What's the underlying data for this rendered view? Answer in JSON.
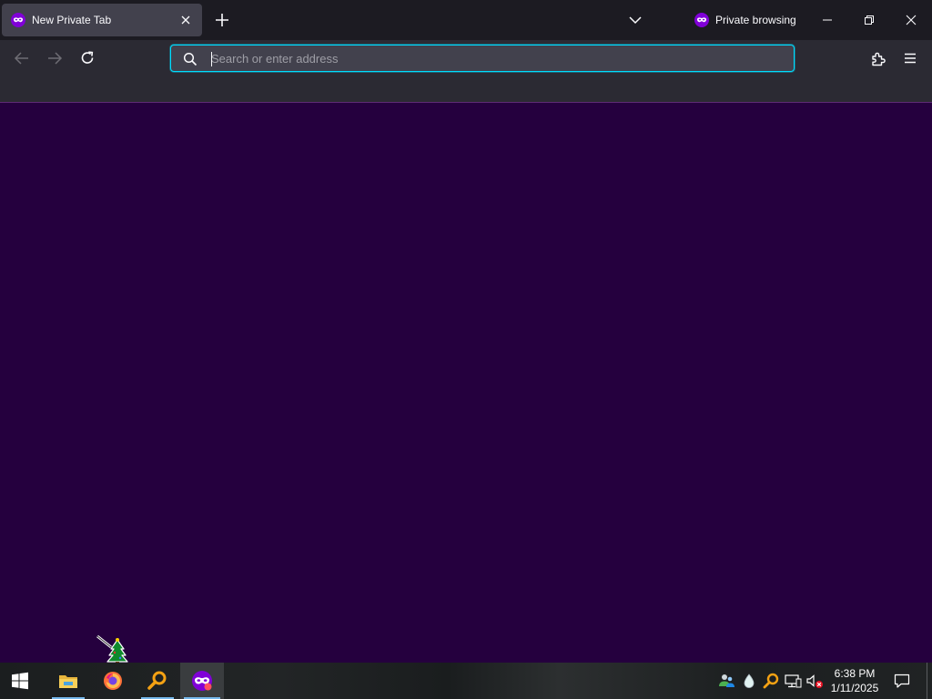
{
  "browser": {
    "tab": {
      "title": "New Private Tab",
      "icon": "private-mask-icon"
    },
    "private_label": "Private browsing",
    "urlbar": {
      "placeholder": "Search or enter address",
      "value": ""
    },
    "accent": "#00ddff",
    "private_purple": "#8000d7",
    "content_background": "#25003e"
  },
  "taskbar": {
    "items": [
      "start-windows-icon",
      "file-explorer-icon",
      "firefox-icon",
      "search-magnifier-icon",
      "firefox-private-icon"
    ],
    "tray": [
      "people-icon",
      "water-drop-icon",
      "magnifier-icon",
      "network-icon",
      "volume-muted-icon"
    ],
    "clock": {
      "time": "6:38 PM",
      "date": "1/11/2025"
    }
  }
}
